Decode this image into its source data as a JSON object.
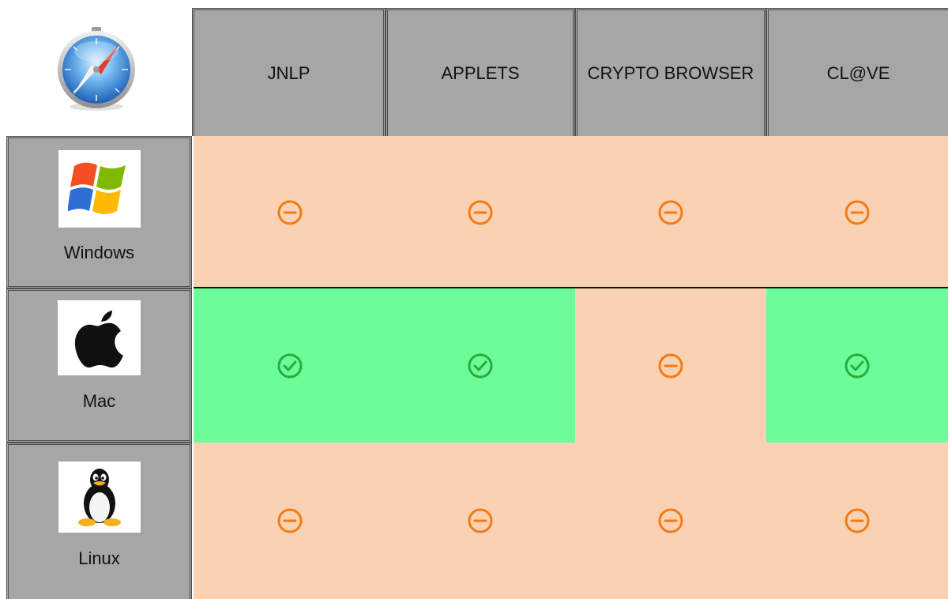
{
  "header": {
    "corner_icon": "safari-browser-icon",
    "columns": [
      {
        "label": "JNLP"
      },
      {
        "label": "APPLETS"
      },
      {
        "label": "CRYPTO BROWSER"
      },
      {
        "label": "CL@VE"
      }
    ]
  },
  "rows": [
    {
      "os": "Windows",
      "icon": "windows-logo-icon",
      "support": [
        "unsupported",
        "unsupported",
        "unsupported",
        "unsupported"
      ]
    },
    {
      "os": "Mac",
      "icon": "apple-logo-icon",
      "support": [
        "supported",
        "supported",
        "unsupported",
        "supported"
      ]
    },
    {
      "os": "Linux",
      "icon": "tux-penguin-icon",
      "support": [
        "unsupported",
        "unsupported",
        "unsupported",
        "unsupported"
      ]
    }
  ],
  "colors": {
    "header_bg": "#a6a6a6",
    "supported_bg": "#6afd99",
    "unsupported_bg": "#f9d2b4",
    "supported_icon": "#2eaa3c",
    "unsupported_icon": "#f57a14"
  },
  "icons": {
    "supported": "check-circle-icon",
    "unsupported": "minus-circle-icon"
  }
}
